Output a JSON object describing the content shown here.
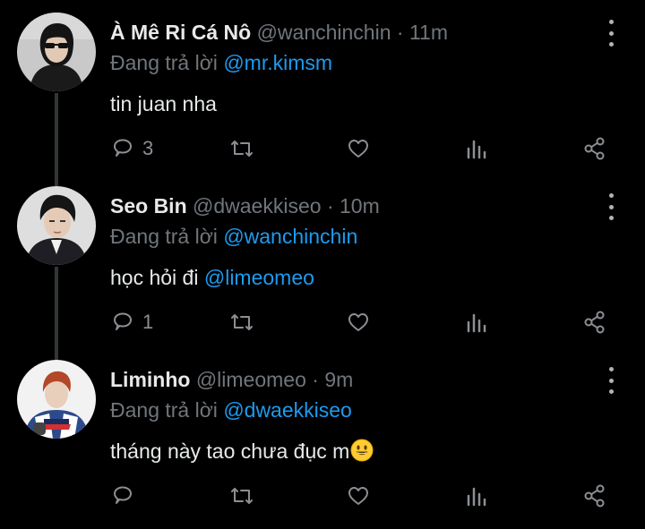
{
  "tweets": [
    {
      "name": "À Mê Ri Cá Nô",
      "handle": "@wanchinchin",
      "separator": "·",
      "time": "11m",
      "replying_prefix": "Đang trả lời",
      "replying_to": "@mr.kimsm",
      "text": "tin juan nha",
      "mention_in_text": "",
      "reply_count": "3",
      "avatar_icon": "person-sunglasses-avatar"
    },
    {
      "name": "Seo Bin",
      "handle": "@dwaekkiseo",
      "separator": "·",
      "time": "10m",
      "replying_prefix": "Đang trả lời",
      "replying_to": "@wanchinchin",
      "text": "học hỏi đi",
      "mention_in_text": "@limeomeo",
      "reply_count": "1",
      "avatar_icon": "person-blazer-avatar"
    },
    {
      "name": "Liminho",
      "handle": "@limeomeo",
      "separator": "·",
      "time": "9m",
      "replying_prefix": "Đang trả lời",
      "replying_to": "@dwaekkiseo",
      "text": "tháng này tao chưa đục m",
      "mention_in_text": "",
      "reply_count": "",
      "avatar_icon": "person-racing-suit-avatar"
    }
  ],
  "icons": {
    "reply": "reply-icon",
    "retweet": "retweet-icon",
    "like": "heart-icon",
    "views": "analytics-icon",
    "share": "share-icon",
    "more": "more-options-icon",
    "emoji": "grinning-face-emoji"
  },
  "colors": {
    "background": "#000000",
    "primary_text": "#e7e9ea",
    "secondary_text": "#71767b",
    "accent": "#1d9bf0",
    "thread_line": "#333639"
  }
}
